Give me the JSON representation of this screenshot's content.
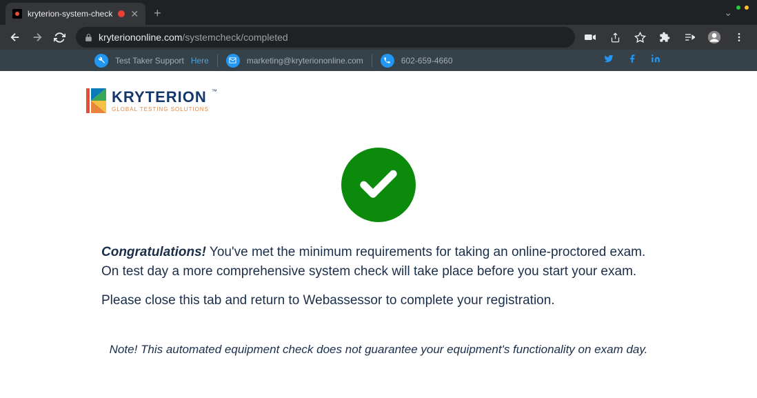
{
  "browser": {
    "tab_title": "kryterion-system-check",
    "url_domain": "kryteriononline.com",
    "url_path": "/systemcheck/completed"
  },
  "infobar": {
    "support_label": "Test Taker Support",
    "support_link": "Here",
    "email": "marketing@kryteriononline.com",
    "phone": "602-659-4660"
  },
  "logo": {
    "name": "KRYTERION",
    "tagline": "GLOBAL TESTING SOLUTIONS",
    "tm": "™"
  },
  "content": {
    "congrats_heading": "Congratulations!",
    "congrats_body": " You've met the minimum requirements for taking an online-proctored exam. On test day a more comprehensive system check will take place before you start your exam.",
    "close_tab": "Please close this tab and return to Webassessor to complete your registration.",
    "note": "Note! This automated equipment check does not guarantee your equipment's functionality on exam day."
  }
}
